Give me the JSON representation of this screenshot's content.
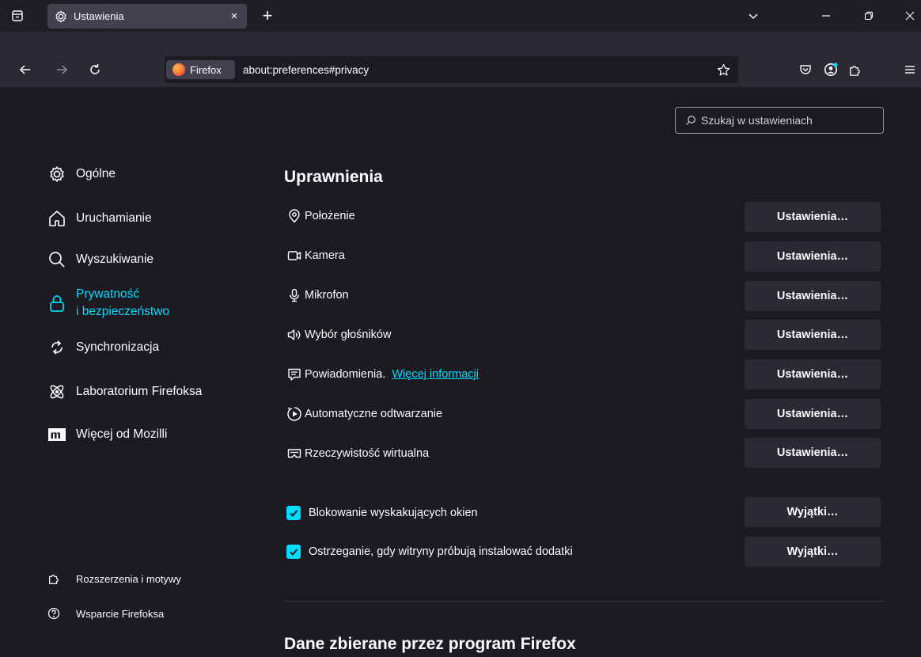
{
  "tab": {
    "title": "Ustawienia",
    "close_glyph": "×",
    "new_glyph": "+"
  },
  "urlbar": {
    "identity_label": "Firefox",
    "url": "about:preferences#privacy"
  },
  "search": {
    "placeholder": "Szukaj w ustawieniach"
  },
  "sidebar": {
    "categories": [
      {
        "label": "Ogólne",
        "icon": "gear-icon"
      },
      {
        "label": "Uruchamianie",
        "icon": "home-icon"
      },
      {
        "label": "Wyszukiwanie",
        "icon": "search-icon"
      },
      {
        "label_line1": "Prywatność",
        "label_line2": "i bezpieczeństwo",
        "icon": "lock-icon",
        "selected": true
      },
      {
        "label": "Synchronizacja",
        "icon": "sync-icon"
      },
      {
        "label": "Laboratorium Firefoksa",
        "icon": "experiments-icon"
      },
      {
        "label": "Więcej od Mozilli",
        "icon": "mozilla-icon"
      }
    ],
    "footer": [
      {
        "label": "Rozszerzenia i motywy",
        "icon": "puzzle-icon"
      },
      {
        "label": "Wsparcie Firefoksa",
        "icon": "help-icon"
      }
    ]
  },
  "permissions": {
    "heading": "Uprawnienia",
    "rows": [
      {
        "label": "Położenie",
        "button": "Ustawienia…",
        "icon": "location-icon"
      },
      {
        "label": "Kamera",
        "button": "Ustawienia…",
        "icon": "camera-icon"
      },
      {
        "label": "Mikrofon",
        "button": "Ustawienia…",
        "icon": "microphone-icon"
      },
      {
        "label": "Wybór głośników",
        "button": "Ustawienia…",
        "icon": "speaker-icon"
      },
      {
        "label": "Powiadomienia.",
        "link": "Więcej informacji",
        "button": "Ustawienia…",
        "icon": "notification-icon"
      },
      {
        "label": "Automatyczne odtwarzanie",
        "button": "Ustawienia…",
        "icon": "autoplay-icon"
      },
      {
        "label": "Rzeczywistość wirtualna",
        "button": "Ustawienia…",
        "icon": "vr-icon"
      }
    ],
    "checkboxes": [
      {
        "label": "Blokowanie wyskakujących okien",
        "button": "Wyjątki…",
        "checked": true
      },
      {
        "label": "Ostrzeganie, gdy witryny próbują instalować dodatki",
        "button": "Wyjątki…",
        "checked": true
      }
    ]
  },
  "next_section": {
    "heading": "Dane zbierane przez program Firefox"
  },
  "colors": {
    "accent": "#00ddff",
    "background": "#1c1b22",
    "toolbar": "#2b2a33",
    "button": "#2b2a33"
  }
}
